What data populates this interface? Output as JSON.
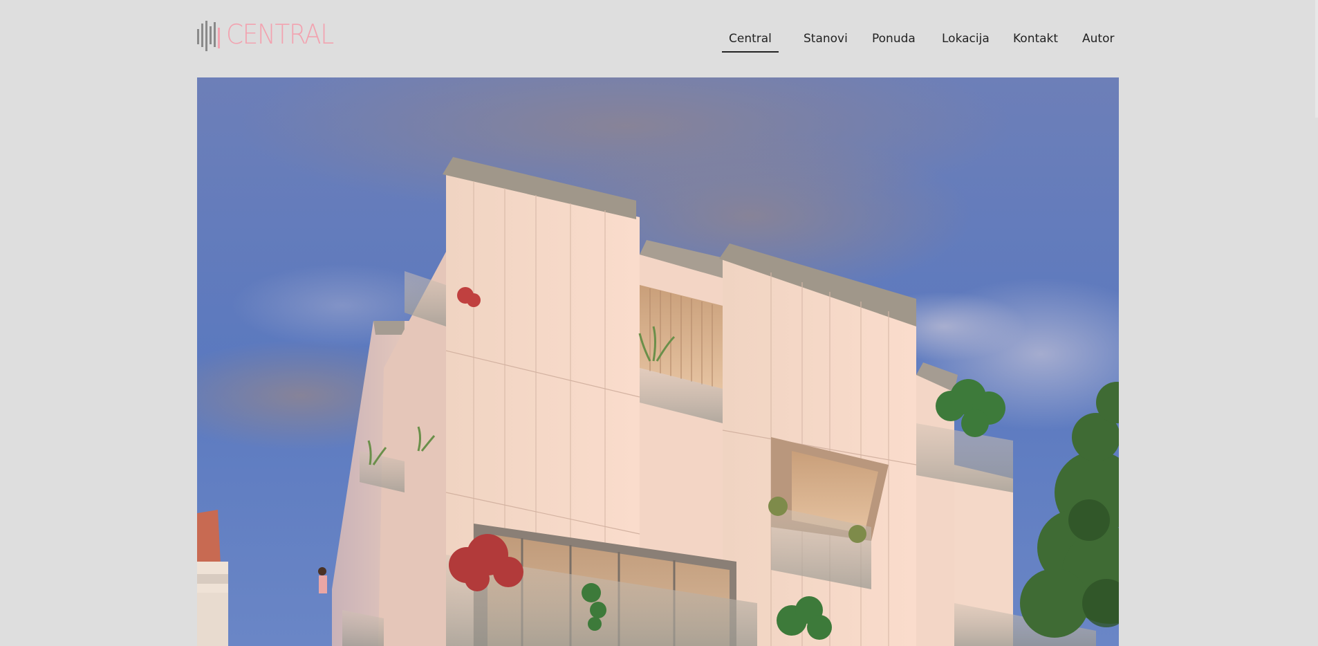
{
  "site": {
    "logo_text": "CENTRAL",
    "brand_color": "#f2a3b0",
    "logo_mark_icon": "equalizer-bars-icon"
  },
  "nav": {
    "items": [
      {
        "label": "Central",
        "active": true
      },
      {
        "label": "Stanovi",
        "active": false
      },
      {
        "label": "Ponuda",
        "active": false
      },
      {
        "label": "Lokacija",
        "active": false
      },
      {
        "label": "Kontakt",
        "active": false
      },
      {
        "label": "Autor",
        "active": false
      }
    ]
  },
  "hero": {
    "image_alt": "Architectural rendering of modern apartment building at dusk"
  }
}
